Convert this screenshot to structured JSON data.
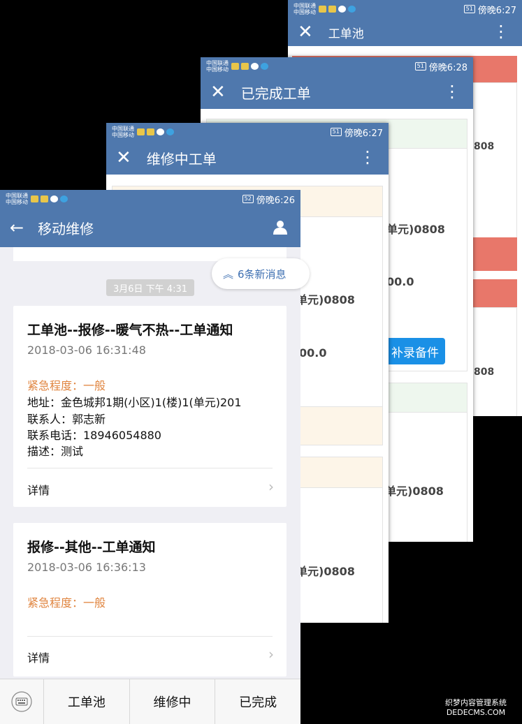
{
  "screens": {
    "pool": {
      "title": "工单池",
      "time": "傍晚6:27",
      "battery": "51",
      "carrier1": "中国联通",
      "carrier2": "中国移动",
      "partial1": "808",
      "partial2": "808"
    },
    "done": {
      "title": "已完成工单",
      "time": "傍晚6:28",
      "battery": "51",
      "carrier1": "中国联通",
      "carrier2": "中国移动",
      "partial1": "单元)0808",
      "partial2": "00.0",
      "button": "补录备件",
      "partial3": "单元)0808"
    },
    "repair": {
      "title": "维修中工单",
      "time": "傍晚6:27",
      "battery": "51",
      "carrier1": "中国联通",
      "carrier2": "中国移动",
      "partial1": "单元)0808",
      "partial2": "00.0",
      "partial3": "单元)0808"
    },
    "main": {
      "title": "移动维修",
      "time": "傍晚6:26",
      "battery": "52",
      "carrier1": "中国联通",
      "carrier2": "中国移动"
    }
  },
  "chat": {
    "date_chip": "3月6日 下午 4:31",
    "new_messages": "6条新消息"
  },
  "cards": [
    {
      "title": "工单池--报修--暖气不热--工单通知",
      "time": "2018-03-06 16:31:48",
      "urgency": "紧急程度：一般",
      "address": "地址：金色城邦1期(小区)1(楼)1(单元)201",
      "contact": "联系人：郭志新",
      "phone": "联系电话：18946054880",
      "desc": "描述：测试",
      "detail": "详情"
    },
    {
      "title": "报修--其他--工单通知",
      "time": "2018-03-06 16:36:13",
      "urgency": "紧急程度：一般",
      "detail": "详情"
    }
  ],
  "tabs": [
    "工单池",
    "维修中",
    "已完成"
  ],
  "colors": {
    "appbar": "#4f78ad",
    "urgency": "#e08540",
    "red_bar": "#e8776a",
    "button": "#1a90e6"
  },
  "icons": {
    "back": "arrow-left-icon",
    "user": "user-icon",
    "close": "close-icon",
    "menu": "more-vert-icon",
    "keyboard": "keyboard-icon",
    "chevron": "chevron-right-icon"
  },
  "watermark": {
    "line1": "织梦内容管理系统",
    "line2": "DEDECMS.COM"
  }
}
